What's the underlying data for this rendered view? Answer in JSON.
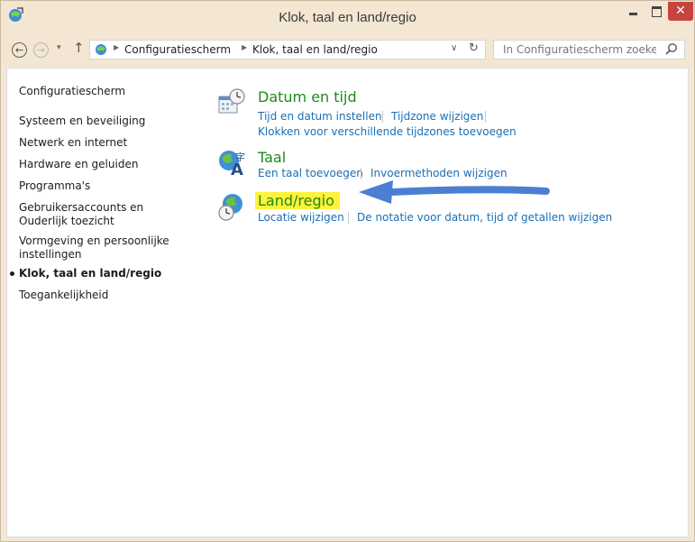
{
  "window": {
    "title": "Klok, taal en land/regio",
    "close_glyph": "✕"
  },
  "nav": {
    "back_glyph": "←",
    "forward_glyph": "→",
    "recent_glyph": "▾",
    "up_glyph": "↑"
  },
  "address": {
    "crumbs": [
      "Configuratiescherm",
      "Klok, taal en land/regio"
    ],
    "separator": "▶",
    "dropdown_glyph": "∨",
    "refresh_glyph": "↻"
  },
  "search": {
    "placeholder": "In Configuratiescherm zoeken"
  },
  "sidebar": {
    "items": [
      {
        "label": "Configuratiescherm"
      },
      {
        "label": "Systeem en beveiliging"
      },
      {
        "label": "Netwerk en internet"
      },
      {
        "label": "Hardware en geluiden"
      },
      {
        "label": "Programma's"
      },
      {
        "label": "Gebruikersaccounts en Ouderlijk toezicht"
      },
      {
        "label": "Vormgeving en persoonlijke instellingen"
      },
      {
        "label": "Klok, taal en land/regio",
        "active": true
      },
      {
        "label": "Toegankelijkheid"
      }
    ]
  },
  "categories": [
    {
      "title": "Datum en tijd",
      "icon": "calendar-clock-icon",
      "links": [
        "Tijd en datum instellen",
        "Tijdzone wijzigen",
        "Klokken voor verschillende tijdzones toevoegen"
      ]
    },
    {
      "title": "Taal",
      "icon": "language-globe-icon",
      "links": [
        "Een taal toevoegen",
        "Invoermethoden wijzigen"
      ]
    },
    {
      "title": "Land/regio",
      "icon": "globe-clock-icon",
      "highlighted": true,
      "links": [
        "Locatie wijzigen",
        "De notatie voor datum, tijd of getallen wijzigen"
      ]
    }
  ],
  "annotation": {
    "arrow_color": "#4a7fd4",
    "highlight_color": "#fff23b"
  }
}
